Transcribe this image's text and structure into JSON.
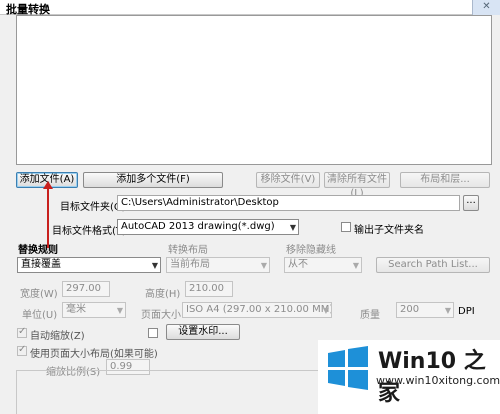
{
  "window": {
    "title": "批量转换",
    "close": "✕"
  },
  "buttons": {
    "add_file": "添加文件(A)",
    "add_multiple": "添加多个文件(F)",
    "remove_file": "移除文件(V)",
    "clear_all": "清除所有文件(L)",
    "layout": "布局和层...",
    "browse": "...",
    "search_path": "Search Path List...",
    "watermark": "设置水印..."
  },
  "target_folder": {
    "label": "目标文件夹(O)",
    "value": "C:\\Users\\Administrator\\Desktop"
  },
  "target_format": {
    "label": "目标文件格式(T)",
    "value": "AutoCAD 2013 drawing(*.dwg)"
  },
  "output_subfolder": {
    "label": "输出子文件夹名",
    "checked": false
  },
  "replace_rule": {
    "label": "替换规则",
    "value": "直接覆盖"
  },
  "convert_layout": {
    "label": "转换布局",
    "value": "当前布局"
  },
  "remove_hidden": {
    "label": "移除隐藏线",
    "value": "从不"
  },
  "width": {
    "label": "宽度(W)",
    "value": "297.00"
  },
  "height": {
    "label": "高度(H)",
    "value": "210.00"
  },
  "unit": {
    "label": "单位(U)",
    "value": "毫米"
  },
  "page_size": {
    "label": "页面大小",
    "value": "ISO A4 (297.00 x 210.00 MM)"
  },
  "quality": {
    "label": "质量",
    "value": "200",
    "unit": "DPI"
  },
  "auto_zoom": {
    "label": "自动缩放(Z)",
    "checked": true
  },
  "use_page_size": {
    "label": "使用页面大小布局(如果可能)",
    "checked": true
  },
  "zoom_ratio": {
    "label": "缩放比例(S)",
    "value": "0.99"
  },
  "watermark_logo": {
    "main": "Win10 之家",
    "url": "www.win10xitong.com"
  },
  "colors": {
    "accent_arrow": "#c8201e",
    "logo_blue": "#1e90d8"
  }
}
